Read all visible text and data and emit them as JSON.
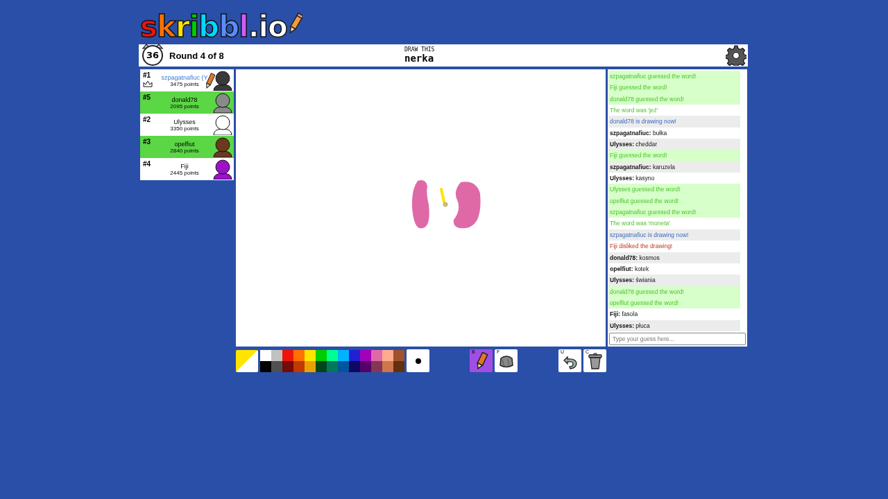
{
  "logo": "skribbl.io",
  "header": {
    "timer": "36",
    "round": "Round 4 of 8",
    "hint_label": "DRAW THIS",
    "word": "nerka"
  },
  "players": [
    {
      "rank": "#1",
      "name": "szpagatnafiuc (Y",
      "points": "3475 points",
      "you": true,
      "guessed": false,
      "drawing": true,
      "owner": true,
      "color": "#3a3a3a"
    },
    {
      "rank": "#5",
      "name": "donald78",
      "points": "2095 points",
      "you": false,
      "guessed": true,
      "drawing": false,
      "owner": false,
      "color": "#8a8a8a"
    },
    {
      "rank": "#2",
      "name": "Ulysses",
      "points": "3350 points",
      "you": false,
      "guessed": false,
      "drawing": false,
      "owner": false,
      "color": "#ffffff"
    },
    {
      "rank": "#3",
      "name": "opelfiut",
      "points": "2840 points",
      "you": false,
      "guessed": true,
      "drawing": false,
      "owner": false,
      "color": "#6b3a1e"
    },
    {
      "rank": "#4",
      "name": "Fiji",
      "points": "2445 points",
      "you": false,
      "guessed": false,
      "drawing": false,
      "owner": false,
      "color": "#9b12c8"
    }
  ],
  "chat": [
    {
      "kind": "guessed",
      "text": "szpagatnafiuc guessed the word!"
    },
    {
      "kind": "guessed",
      "text": "Fiji guessed the word!"
    },
    {
      "kind": "guessed",
      "text": "donald78 guessed the word!"
    },
    {
      "kind": "reveal",
      "text": "The word was 'jeż'"
    },
    {
      "kind": "drawing",
      "text": "donald78 is drawing now!"
    },
    {
      "kind": "message",
      "name": "szpagatnafiuc:",
      "text": "bułka"
    },
    {
      "kind": "message",
      "name": "Ulysses:",
      "text": "cheddar"
    },
    {
      "kind": "guessed",
      "text": "Fiji guessed the word!"
    },
    {
      "kind": "message",
      "name": "szpagatnafiuc:",
      "text": "karuzela"
    },
    {
      "kind": "message",
      "name": "Ulysses:",
      "text": "kasyno"
    },
    {
      "kind": "guessed",
      "text": "Ulysses guessed the word!"
    },
    {
      "kind": "guessed",
      "text": "opelfiut guessed the word!"
    },
    {
      "kind": "guessed",
      "text": "szpagatnafiuc guessed the word!"
    },
    {
      "kind": "reveal",
      "text": "The word was 'moneta'"
    },
    {
      "kind": "drawing",
      "text": "szpagatnafiuc is drawing now!"
    },
    {
      "kind": "dislike",
      "text": "Fiji disliked the drawing!"
    },
    {
      "kind": "message",
      "name": "donald78:",
      "text": "kosmos"
    },
    {
      "kind": "message",
      "name": "opelfiut:",
      "text": "kotek"
    },
    {
      "kind": "message",
      "name": "Ulysses:",
      "text": "świania"
    },
    {
      "kind": "guessed",
      "text": "donald78 guessed the word!"
    },
    {
      "kind": "guessed",
      "text": "opelfiut guessed the word!"
    },
    {
      "kind": "message",
      "name": "Fiji:",
      "text": "fasola"
    },
    {
      "kind": "message",
      "name": "Ulysses:",
      "text": "płuca"
    }
  ],
  "chat_input": {
    "placeholder": "Type your guess here..."
  },
  "current_colors": [
    {
      "color": "#ffe400"
    },
    {
      "color": "#ffffff"
    }
  ],
  "palette": [
    {
      "color": "#ffffff"
    },
    {
      "color": "#c1c1c1"
    },
    {
      "color": "#ef130b"
    },
    {
      "color": "#ff7100"
    },
    {
      "color": "#ffe400"
    },
    {
      "color": "#00cc00"
    },
    {
      "color": "#00ff91"
    },
    {
      "color": "#00b2ff"
    },
    {
      "color": "#231fd3"
    },
    {
      "color": "#a300ba"
    },
    {
      "color": "#df69a7"
    },
    {
      "color": "#ffac8e"
    },
    {
      "color": "#a0522d"
    },
    {
      "color": "#000000"
    },
    {
      "color": "#505050"
    },
    {
      "color": "#740b07"
    },
    {
      "color": "#c23800"
    },
    {
      "color": "#e8a200"
    },
    {
      "color": "#004619"
    },
    {
      "color": "#00785d"
    },
    {
      "color": "#00569e"
    },
    {
      "color": "#0e0865"
    },
    {
      "color": "#550069"
    },
    {
      "color": "#873554"
    },
    {
      "color": "#cc774d"
    },
    {
      "color": "#63300d"
    }
  ],
  "tools": [
    {
      "kind": "pencil",
      "key": "B",
      "selected": true
    },
    {
      "kind": "fill",
      "key": "F",
      "selected": false
    },
    {
      "kind": "undo",
      "key": "U",
      "selected": false
    },
    {
      "kind": "clear",
      "key": "C",
      "selected": false
    }
  ]
}
